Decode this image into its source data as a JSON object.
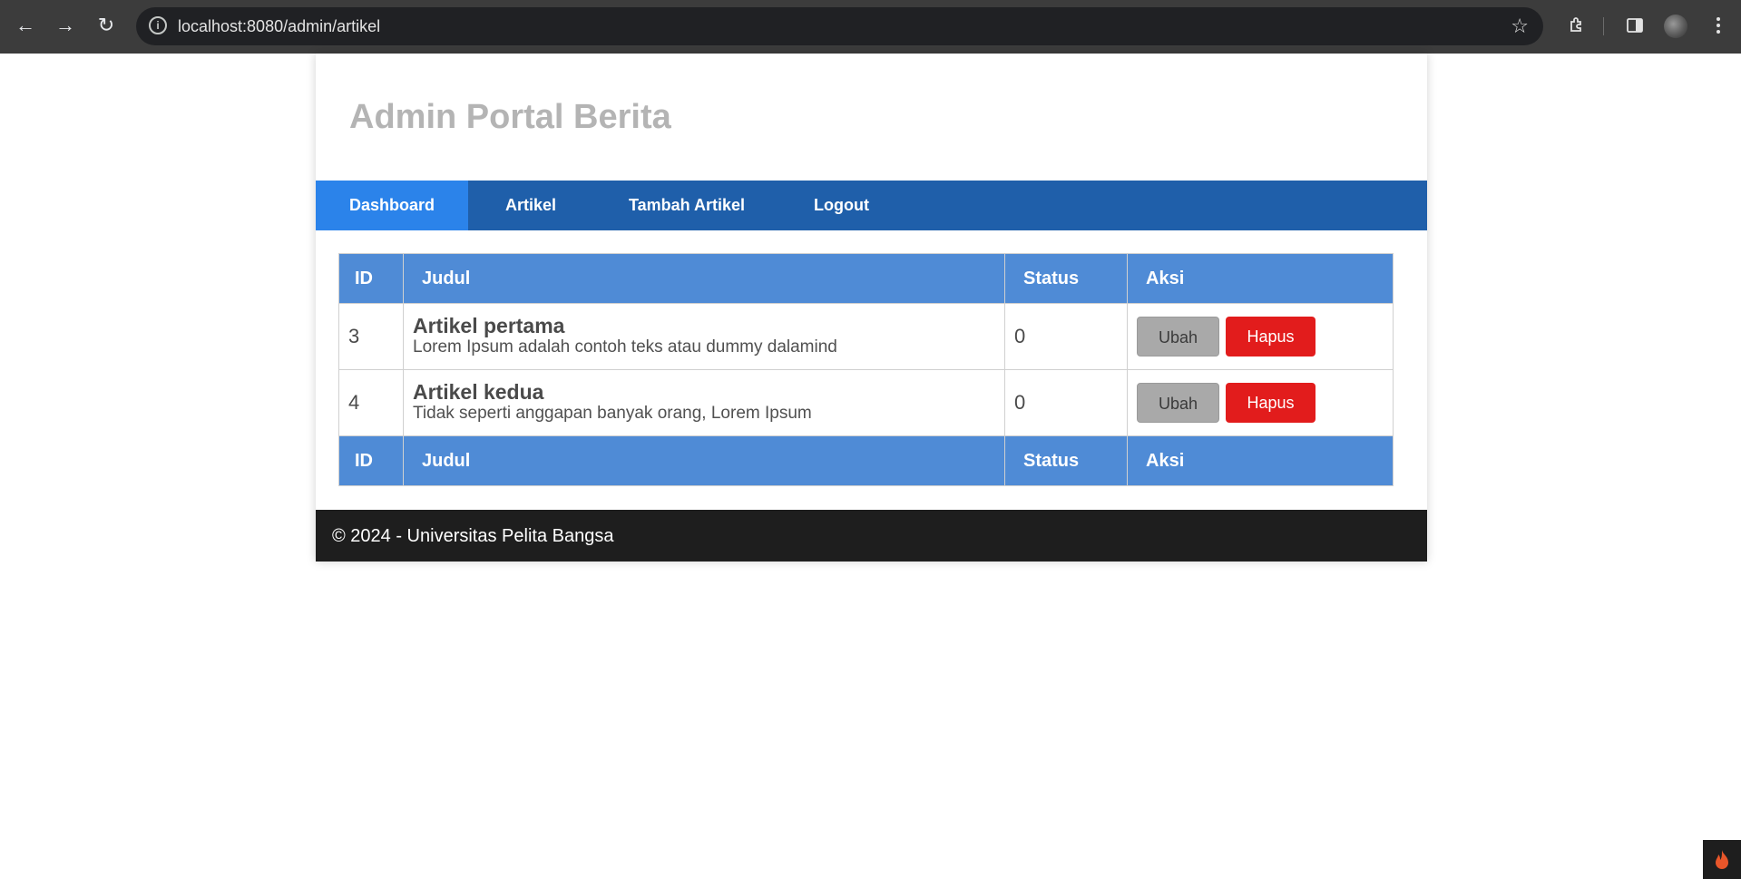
{
  "browser": {
    "url": "localhost:8080/admin/artikel",
    "back_icon": "←",
    "forward_icon": "→",
    "reload_icon": "↻",
    "star_icon": "☆"
  },
  "header": {
    "title": "Admin Portal Berita"
  },
  "nav": {
    "items": [
      {
        "label": "Dashboard",
        "active": true
      },
      {
        "label": "Artikel"
      },
      {
        "label": "Tambah Artikel"
      },
      {
        "label": "Logout"
      }
    ]
  },
  "table": {
    "columns": [
      "ID",
      "Judul",
      "Status",
      "Aksi"
    ],
    "rows": [
      {
        "id": "3",
        "title": "Artikel pertama",
        "excerpt": "Lorem Ipsum adalah contoh teks atau dummy dalamind",
        "status": "0",
        "edit": "Ubah",
        "delete": "Hapus"
      },
      {
        "id": "4",
        "title": "Artikel kedua",
        "excerpt": "Tidak seperti anggapan banyak orang, Lorem Ipsum",
        "status": "0",
        "edit": "Ubah",
        "delete": "Hapus"
      }
    ]
  },
  "footer": {
    "text": "© 2024 - Universitas Pelita Bangsa"
  },
  "colors": {
    "nav": "#1f5faa",
    "nav_active": "#2b83ea",
    "table_header": "#4f8bd6",
    "delete": "#e21c1c",
    "edit": "#a9a9a9",
    "footer": "#1e1e1e"
  }
}
